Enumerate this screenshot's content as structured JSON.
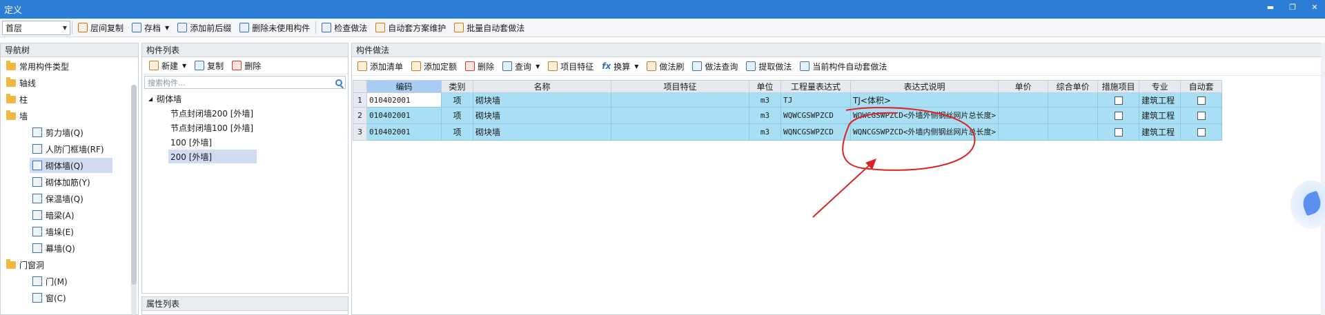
{
  "window": {
    "title": "定义",
    "controls": [
      "▬",
      "❐",
      "✕"
    ]
  },
  "toolbar": {
    "floor": "首层",
    "buttons": [
      "层间复制",
      "存档",
      "添加前后缀",
      "删除未使用构件",
      "检查做法",
      "自动套方案维护",
      "批量自动套做法"
    ]
  },
  "nav": {
    "title": "导航树",
    "items": [
      {
        "label": "常用构件类型"
      },
      {
        "label": "轴线"
      },
      {
        "label": "柱"
      },
      {
        "label": "墙"
      },
      {
        "label": "剪力墙(Q)"
      },
      {
        "label": "人防门框墙(RF)"
      },
      {
        "label": "砌体墙(Q)"
      },
      {
        "label": "砌体加筋(Y)"
      },
      {
        "label": "保温墙(Q)"
      },
      {
        "label": "暗梁(A)"
      },
      {
        "label": "墙垛(E)"
      },
      {
        "label": "幕墙(Q)"
      },
      {
        "label": "门窗洞"
      },
      {
        "label": "门(M)"
      },
      {
        "label": "窗(C)"
      }
    ]
  },
  "components": {
    "title": "构件列表",
    "actions": [
      "新建",
      "复制",
      "删除"
    ],
    "search_placeholder": "搜索构件...",
    "group": "砌体墙",
    "items": [
      "节点封闭墙200 [外墙]",
      "节点封闭墙100 [外墙]",
      "100 [外墙]",
      "200 [外墙]"
    ]
  },
  "properties": {
    "title": "属性列表"
  },
  "method": {
    "title": "构件做法",
    "actions": [
      "添加清单",
      "添加定额",
      "删除",
      "查询",
      "项目特征",
      "换算",
      "做法刷",
      "做法查询",
      "提取做法",
      "当前构件自动套做法"
    ],
    "columns": [
      "编码",
      "类别",
      "名称",
      "项目特征",
      "单位",
      "工程量表达式",
      "表达式说明",
      "单价",
      "综合单价",
      "措施项目",
      "专业",
      "自动套"
    ],
    "rows": [
      {
        "no": "1",
        "code": "010402001",
        "type": "项",
        "name": "砌块墙",
        "feature": "",
        "unit": "m3",
        "expr": "TJ",
        "desc": "TJ<体积>",
        "price": "",
        "total": "",
        "major": "建筑工程"
      },
      {
        "no": "2",
        "code": "010402001",
        "type": "项",
        "name": "砌块墙",
        "feature": "",
        "unit": "m3",
        "expr": "WQWCGSWPZCD",
        "desc": "WQWCGSWPZCD<外墙外侧钢丝网片总长度>",
        "price": "",
        "total": "",
        "major": "建筑工程"
      },
      {
        "no": "3",
        "code": "010402001",
        "type": "项",
        "name": "砌块墙",
        "feature": "",
        "unit": "m3",
        "expr": "WQNCGSWPZCD",
        "desc": "WQNCGSWPZCD<外墙内侧钢丝网片总长度>",
        "price": "",
        "total": "",
        "major": "建筑工程"
      }
    ]
  },
  "colors": {
    "titlebar": "#2b7dd6",
    "row_fill": "#a9dff4",
    "annotation": "#e02020"
  }
}
